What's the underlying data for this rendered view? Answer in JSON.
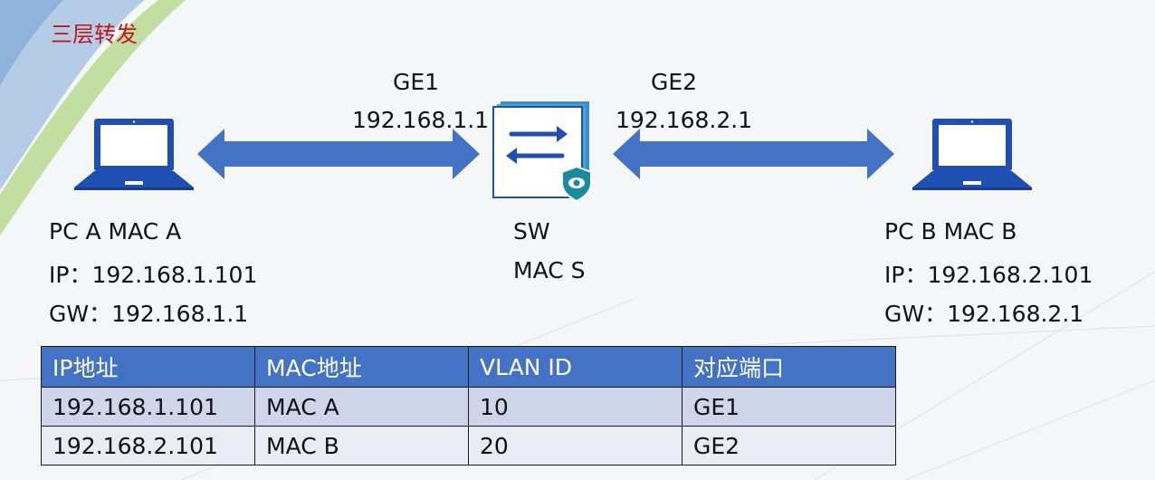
{
  "title": "三层转发",
  "pc_a": {
    "line1": "PC A MAC A",
    "line2": "IP：192.168.1.101",
    "line3": "GW：192.168.1.1"
  },
  "pc_b": {
    "line1": "PC B MAC B",
    "line2": "IP：192.168.2.101",
    "line3": "GW：192.168.2.1"
  },
  "switch": {
    "name": "SW",
    "mac": "MAC S"
  },
  "port1": {
    "name": "GE1",
    "ip": "192.168.1.1"
  },
  "port2": {
    "name": "GE2",
    "ip": "192.168.2.1"
  },
  "colors": {
    "accent": "#4472c4",
    "title": "#c0171b",
    "device": "#1f4fb0",
    "arrow": "#4472c4"
  },
  "table": {
    "headers": [
      "IP地址",
      "MAC地址",
      "VLAN ID",
      "对应端口"
    ],
    "rows": [
      [
        "192.168.1.101",
        "MAC A",
        "10",
        "GE1"
      ],
      [
        "192.168.2.101",
        "MAC B",
        "20",
        "GE2"
      ]
    ]
  }
}
